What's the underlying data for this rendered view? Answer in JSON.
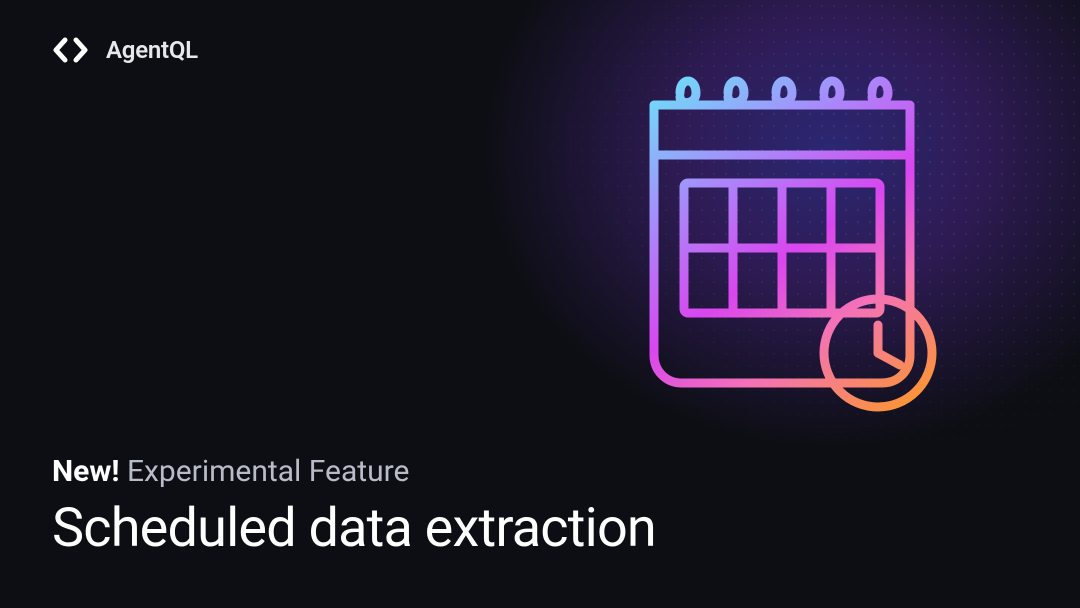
{
  "brand": {
    "name": "AgentQL"
  },
  "eyebrow": {
    "badge": "New!",
    "text": "Experimental Feature"
  },
  "headline": "Scheduled data extraction"
}
